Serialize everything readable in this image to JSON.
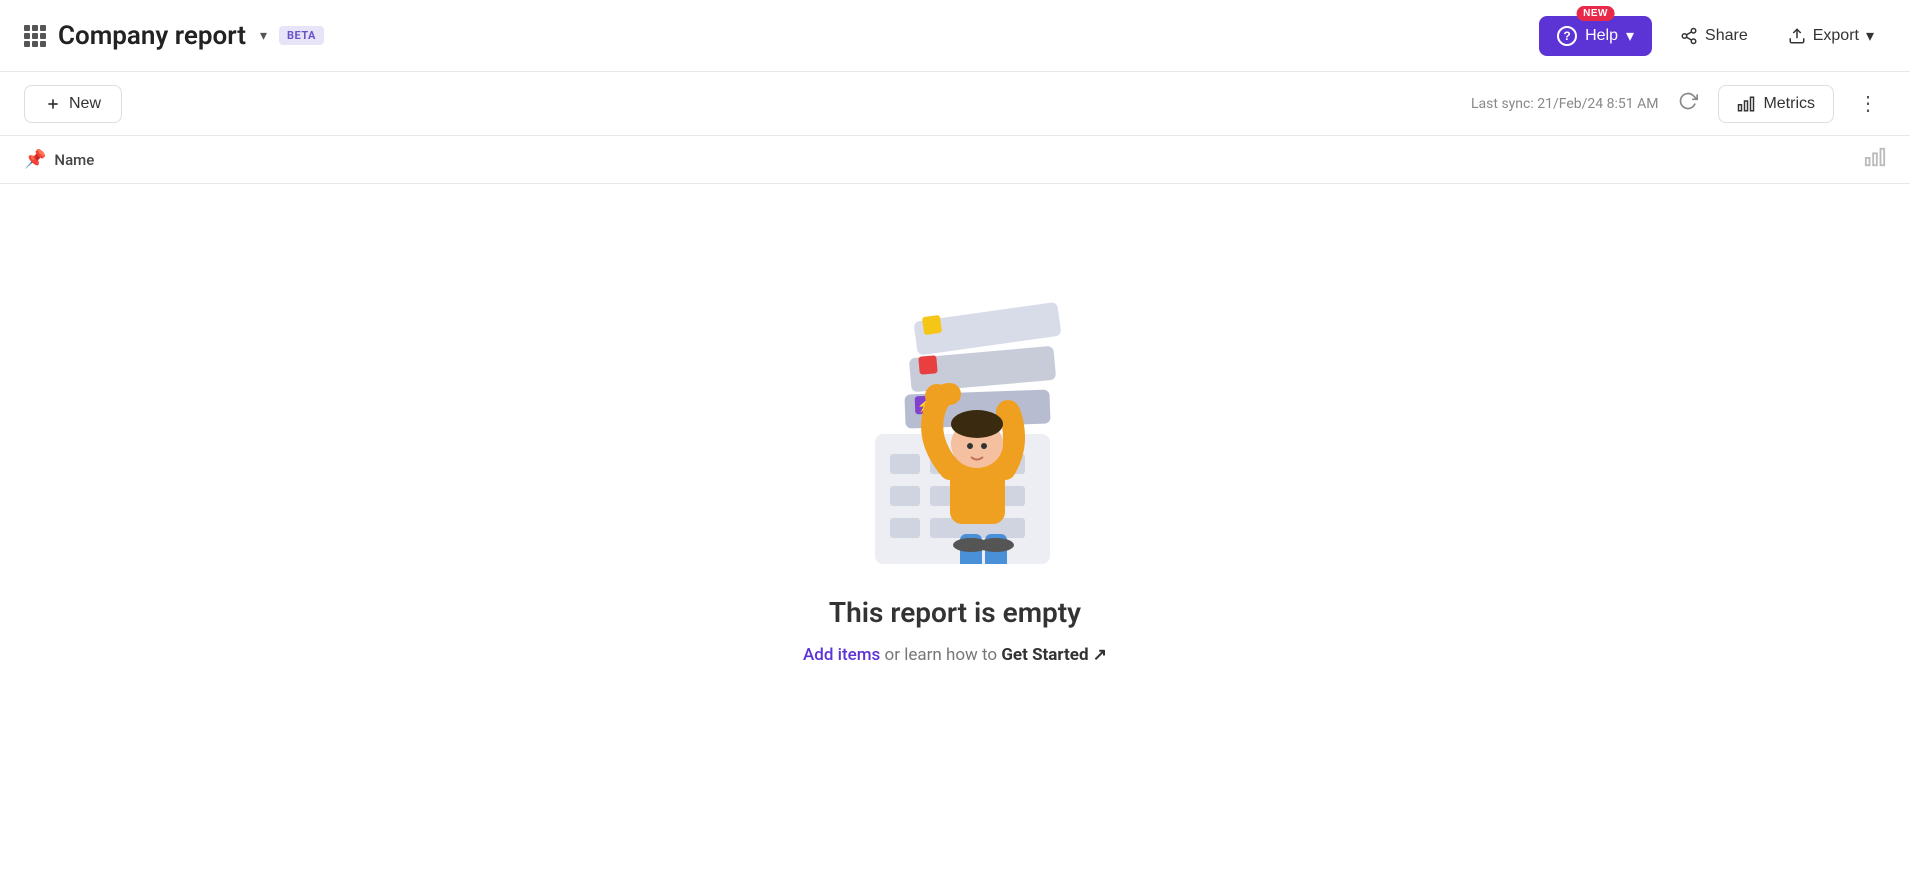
{
  "header": {
    "grid_icon": "grid-icon",
    "title": "Company report",
    "dropdown_label": "▾",
    "beta_label": "BETA",
    "help_new_badge": "NEW",
    "help_label": "Help",
    "help_dropdown": "▾",
    "share_label": "Share",
    "export_label": "Export",
    "export_dropdown": "▾"
  },
  "toolbar": {
    "new_label": "New",
    "last_sync_label": "Last sync: 21/Feb/24 8:51 AM",
    "metrics_label": "Metrics",
    "more_icon": "⋮"
  },
  "column_header": {
    "pin_icon": "📌",
    "name_label": "Name"
  },
  "empty_state": {
    "title": "This report is empty",
    "subtitle_plain1": " or learn how to ",
    "add_items_label": "Add items",
    "get_started_label": "Get Started ↗"
  },
  "colors": {
    "accent_purple": "#5c33d4",
    "beta_bg": "#e8e4f8",
    "beta_text": "#6b52c8",
    "new_badge_bg": "#e8294a",
    "toolbar_border": "#e8e8e8"
  }
}
